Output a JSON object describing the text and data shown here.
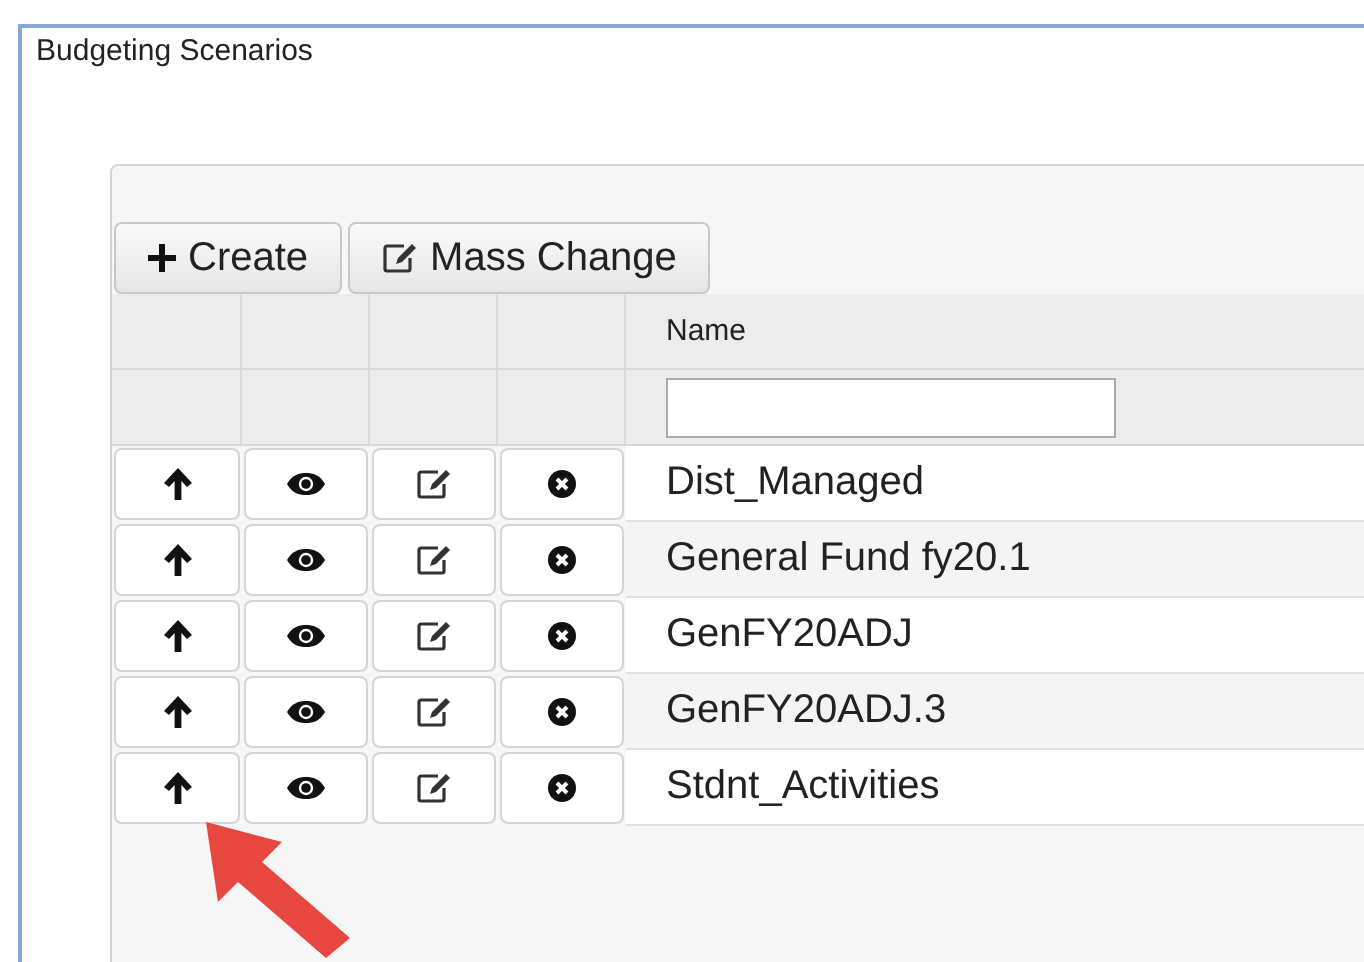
{
  "window": {
    "title": "Budgeting Scenarios"
  },
  "toolbar": {
    "buttons": [
      {
        "label": "Create"
      },
      {
        "label": "Mass Change"
      }
    ]
  },
  "table": {
    "columns": [
      {
        "label": "Name"
      }
    ],
    "rows": [
      {
        "name": "Dist_Managed"
      },
      {
        "name": "General Fund fy20.1"
      },
      {
        "name": "GenFY20ADJ"
      },
      {
        "name": "GenFY20ADJ.3"
      },
      {
        "name": "Stdnt_Activities"
      }
    ]
  }
}
